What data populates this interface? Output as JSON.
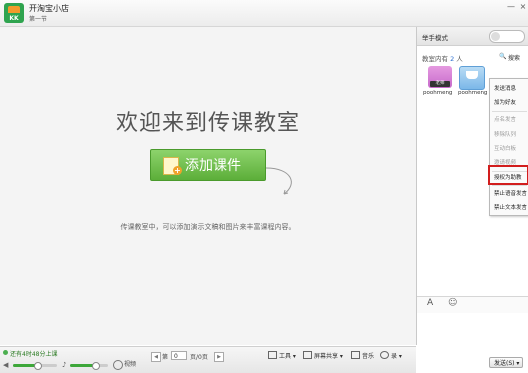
{
  "app": {
    "logo_text": "KK",
    "title": "开淘宝小店",
    "subtitle": "第一节"
  },
  "window": {
    "minimize_glyph": "—",
    "close_glyph": "×"
  },
  "classroom": {
    "welcome": "欢迎来到传课教室",
    "add_button": "添加课件",
    "hint": "传课教室中，可以添加演示文稿和图片来丰富课程内容。"
  },
  "bottom_bar": {
    "status": "还有4时48分上课",
    "volume_level": 0.55,
    "mic_level": 0.65,
    "video_label": "视频",
    "page_label_before": "第",
    "page_value": "0",
    "page_label_after": "页/0页",
    "tools": [
      {
        "label": "工具 ▾",
        "icon": "tools-icon"
      },
      {
        "label": "屏幕共享 ▾",
        "icon": "screen-share-icon"
      },
      {
        "label": "音乐",
        "icon": "music-icon"
      },
      {
        "label": "录 ▾",
        "icon": "record-icon"
      }
    ]
  },
  "right_panel": {
    "title": "举手模式",
    "count_prefix": "教室内有",
    "count_value": "2",
    "count_suffix": "人",
    "search_label": "搜索",
    "members": [
      {
        "name": "poohmeng",
        "badge": "老师"
      },
      {
        "name": "poohmeng"
      }
    ],
    "context_menu": {
      "groups": [
        [
          {
            "label": "发送消息",
            "enabled": true
          },
          {
            "label": "加为好友",
            "enabled": true
          }
        ],
        [
          {
            "label": "点名发言",
            "enabled": false
          },
          {
            "label": "移除队列",
            "enabled": false
          },
          {
            "label": "互动白板",
            "enabled": false
          },
          {
            "label": "邀请视频",
            "enabled": false
          }
        ],
        [
          {
            "label": "授权为助教",
            "enabled": true,
            "highlighted": true
          }
        ],
        [
          {
            "label": "禁止语音发言",
            "enabled": true
          },
          {
            "label": "禁止文本发言",
            "enabled": true
          }
        ]
      ]
    },
    "chat": {
      "font_glyph": "A",
      "emoji_glyph": "☺",
      "send_label": "发送(S) ▾"
    }
  },
  "colors": {
    "accent_green": "#5cae39",
    "highlight_red": "#d21d1d",
    "link_blue": "#2a6ecf"
  }
}
